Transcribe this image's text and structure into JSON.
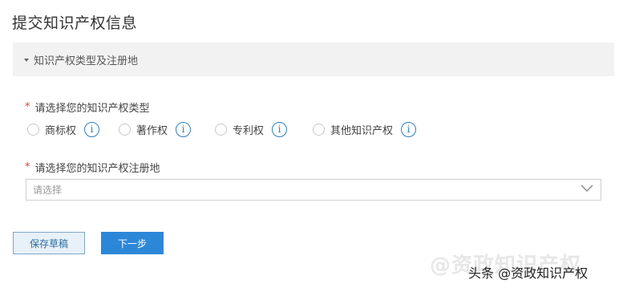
{
  "page": {
    "title": "提交知识产权信息"
  },
  "section": {
    "label": "知识产权类型及注册地"
  },
  "ip_type": {
    "required_mark": "*",
    "label": "请选择您的知识产权类型",
    "options": [
      {
        "label": "商标权",
        "info": "i"
      },
      {
        "label": "著作权",
        "info": "i"
      },
      {
        "label": "专利权",
        "info": "i"
      },
      {
        "label": "其他知识产权",
        "info": "i"
      }
    ]
  },
  "registration": {
    "required_mark": "*",
    "label": "请选择您的知识产权注册地",
    "placeholder": "请选择"
  },
  "buttons": {
    "save_draft": "保存草稿",
    "next": "下一步"
  },
  "watermark": {
    "faint": "@资政知识产权",
    "text": "头条 @资政知识产权"
  }
}
